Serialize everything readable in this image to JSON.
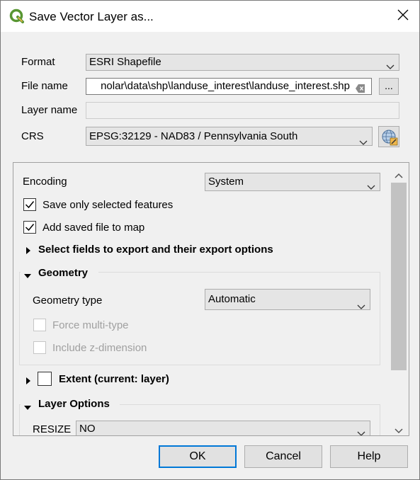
{
  "window": {
    "title": "Save Vector Layer as...",
    "app_icon": "qgis-logo-icon",
    "close_icon": "close-icon"
  },
  "format": {
    "label": "Format",
    "value": "ESRI Shapefile"
  },
  "file_name": {
    "label": "File name",
    "value": "nolar\\data\\shp\\landuse_interest\\landuse_interest.shp",
    "browse_label": "..."
  },
  "layer_name": {
    "label": "Layer name",
    "value": ""
  },
  "crs": {
    "label": "CRS",
    "value": "EPSG:32129 - NAD83 / Pennsylvania South",
    "select_icon": "globe-projection-icon"
  },
  "options": {
    "encoding": {
      "label": "Encoding",
      "value": "System"
    },
    "save_selected": {
      "label": "Save only selected features",
      "checked": true
    },
    "add_to_map": {
      "label": "Add saved file to map",
      "checked": true
    },
    "select_fields": {
      "label": "Select fields to export and their export options",
      "expanded": false
    },
    "geometry": {
      "label": "Geometry",
      "expanded": true,
      "type_label": "Geometry type",
      "type_value": "Automatic",
      "force_multi": {
        "label": "Force multi-type",
        "checked": false,
        "enabled": false
      },
      "include_z": {
        "label": "Include z-dimension",
        "checked": false,
        "enabled": false
      }
    },
    "extent": {
      "label": "Extent (current: layer)",
      "checked": false,
      "expanded": false
    },
    "layer_options": {
      "label": "Layer Options",
      "expanded": true,
      "resize": {
        "label": "RESIZE",
        "value": "NO"
      }
    }
  },
  "buttons": {
    "ok": "OK",
    "cancel": "Cancel",
    "help": "Help"
  },
  "colors": {
    "accent": "#0078d7",
    "qgis_green": "#589632",
    "qgis_yellow": "#eeb64b"
  }
}
